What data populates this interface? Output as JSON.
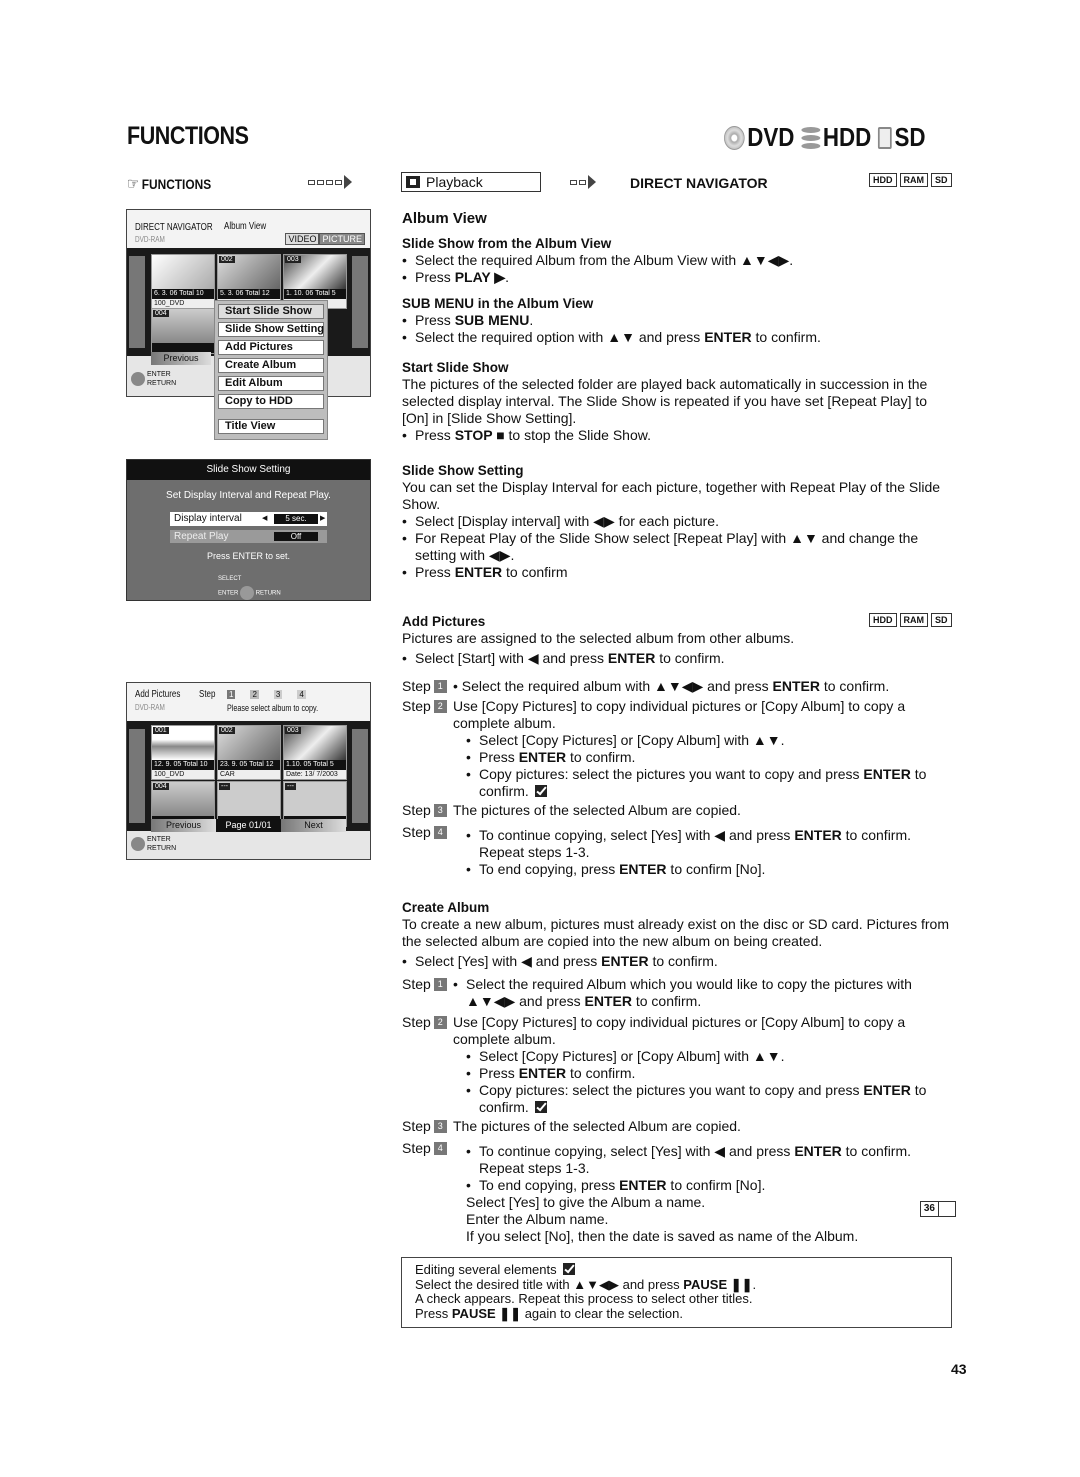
{
  "header": {
    "title": "FUNCTIONS",
    "media": [
      {
        "icon": "dvd-disc-icon",
        "label": "DVD"
      },
      {
        "icon": "hdd-icon",
        "label": "HDD"
      },
      {
        "icon": "sd-card-icon",
        "label": "SD"
      }
    ]
  },
  "breadcrumb": {
    "hand_icon": "☞",
    "functions": "FUNCTIONS",
    "playback": "Playback",
    "direct_navigator": "DIRECT NAVIGATOR",
    "badges": [
      "HDD",
      "RAM",
      "SD"
    ]
  },
  "screen_album_view": {
    "title": "DIRECT NAVIGATOR",
    "view": "Album View",
    "disc": "DVD-RAM",
    "tabs": [
      "VIDEO",
      "PICTURE"
    ],
    "thumbs": [
      {
        "num": "",
        "meta": "6. 3. 06    Total 10",
        "name": "100_DVD"
      },
      {
        "num": "002",
        "meta": "5. 3. 06    Total 12",
        "name": ""
      },
      {
        "num": "003",
        "meta": "1. 10. 06    Total 5",
        "name": ""
      },
      {
        "num": "004",
        "meta": "",
        "name": ""
      }
    ],
    "previous": "Previous",
    "enter": "ENTER",
    "return": "RETURN",
    "submenu": [
      "Start Slide Show",
      "Slide Show Setting",
      "Add Pictures",
      "Create Album",
      "Edit Album",
      "Copy to HDD",
      "Title View"
    ]
  },
  "screen_slide_setting": {
    "title": "Slide Show Setting",
    "subtitle": "Set Display Interval and Repeat Play.",
    "display_interval_label": "Display interval",
    "display_interval_value": "5 sec.",
    "repeat_play_label": "Repeat Play",
    "repeat_play_value": "Off",
    "press_enter": "Press ENTER to set.",
    "select": "SELECT",
    "enter": "ENTER",
    "return": "RETURN"
  },
  "screen_add_pictures": {
    "title": "Add Pictures",
    "step_label": "Step",
    "steps": [
      "1",
      "2",
      "3",
      "4"
    ],
    "disc": "DVD-RAM",
    "instruction": "Please select album to copy.",
    "thumbs": [
      {
        "num": "001",
        "meta": "12. 9. 05    Total 10",
        "name": "100_DVD"
      },
      {
        "num": "002",
        "meta": "23. 9. 05   Total 12",
        "name": "CAR"
      },
      {
        "num": "003",
        "meta": "1.10. 05    Total 5",
        "name": "Date: 13/ 7/2003"
      },
      {
        "num": "004",
        "meta": "",
        "name": ""
      },
      {
        "num": "---",
        "meta": "",
        "name": ""
      },
      {
        "num": "---",
        "meta": "",
        "name": ""
      }
    ],
    "previous": "Previous",
    "page": "Page 01/01",
    "next": "Next",
    "enter": "ENTER",
    "return": "RETURN"
  },
  "content": {
    "album_view": "Album View",
    "ss_from_album": {
      "heading": "Slide Show from the Album View",
      "b1": "Select the required Album from the Album View with ▲▼◀▶.",
      "b2_pre": "Press ",
      "b2_bold": "PLAY ▶",
      "b2_post": "."
    },
    "submenu_section": {
      "heading": "SUB MENU in the Album View",
      "b1_pre": "Press ",
      "b1_bold": "SUB MENU",
      "b1_post": ".",
      "b2_pre": "Select the required option with ▲▼ and press ",
      "b2_bold": "ENTER",
      "b2_post": " to confirm."
    },
    "start_slide_show": {
      "heading": "Start Slide Show",
      "body": "The pictures of the selected folder are played back automatically in succession in the selected display interval. The Slide Show is repeated if you have set [Repeat Play] to [On] in [Slide Show Setting].",
      "b1_pre": "Press ",
      "b1_bold": "STOP ■",
      "b1_post": " to stop the Slide Show."
    },
    "slide_show_setting": {
      "heading": "Slide Show Setting",
      "body": "You can set the Display Interval for each picture, together with Repeat Play of the Slide Show.",
      "b1": "Select [Display interval] with ◀▶ for each picture.",
      "b2": "For Repeat Play of the Slide Show select [Repeat Play] with ▲▼ and change the setting with ◀▶.",
      "b3_pre": "Press ",
      "b3_bold": "ENTER",
      "b3_post": " to confirm"
    },
    "add_pictures": {
      "heading": "Add Pictures",
      "badges": [
        "HDD",
        "RAM",
        "SD"
      ],
      "body": "Pictures are assigned to the selected album from other albums.",
      "b1_pre": "Select [Start] with ◀ and press ",
      "b1_bold": "ENTER",
      "b1_post": " to confirm.",
      "step_word": "Step",
      "s1_pre": "•  Select the required album with ▲▼◀▶ and press ",
      "s1_bold": "ENTER",
      "s1_post": " to confirm.",
      "s2": "Use [Copy Pictures] to copy individual pictures or [Copy Album] to copy a complete album.",
      "s2_b1": "Select [Copy Pictures] or [Copy Album] with ▲▼.",
      "s2_b2_pre": "Press ",
      "s2_b2_bold": "ENTER",
      "s2_b2_post": " to confirm.",
      "s2_b3_pre": "Copy pictures: select the pictures you want to copy and press ",
      "s2_b3_bold": "ENTER",
      "s2_b3_post": " to confirm.",
      "s3": "The pictures of the selected Album are copied.",
      "s4_b1_pre": "To continue copying, select [Yes] with ◀ and press ",
      "s4_b1_bold": "ENTER",
      "s4_b1_post": " to confirm.",
      "s4_b1_line2": "Repeat steps 1-3.",
      "s4_b2_pre": "To end copying, press ",
      "s4_b2_bold": "ENTER",
      "s4_b2_post": " to confirm [No]."
    },
    "create_album": {
      "heading": "Create Album",
      "body": "To create a new album, pictures must already exist on the disc or SD card. Pictures from the selected album are copied into the new album on being created.",
      "b1_pre": "Select [Yes] with ◀ and press ",
      "b1_bold": "ENTER",
      "b1_post": " to confirm.",
      "step_word": "Step",
      "s1_pre": "Select the required Album which you would like to copy the pictures with ▲▼◀▶ and press ",
      "s1_bold": "ENTER",
      "s1_post": " to confirm.",
      "s2": "Use [Copy Pictures] to copy individual pictures or [Copy Album] to copy a complete album.",
      "s2_b1": "Select [Copy Pictures] or [Copy Album] with ▲▼.",
      "s2_b2_pre": "Press ",
      "s2_b2_bold": "ENTER",
      "s2_b2_post": " to confirm.",
      "s2_b3_pre": "Copy pictures: select the pictures you want to copy and press ",
      "s2_b3_bold": "ENTER",
      "s2_b3_post": " to confirm.",
      "s3": "The pictures of the selected Album are copied.",
      "s4_b1_pre": "To continue copying, select [Yes] with ◀ and press ",
      "s4_b1_bold": "ENTER",
      "s4_b1_post": " to confirm.",
      "s4_b1_line2": "Repeat steps 1-3.",
      "s4_b2_pre": "To end copying, press ",
      "s4_b2_bold": "ENTER",
      "s4_b2_post": " to confirm [No].",
      "s4_l3": "Select [Yes] to give the Album a name.",
      "s4_l4": "Enter the Album name.",
      "s4_l5": "If you select [No], then the date is saved as name of the Album.",
      "page_ref": "36"
    }
  },
  "note": {
    "l1": "Editing several elements",
    "l2_pre": "Select the desired title with ▲▼◀▶ and press ",
    "l2_bold": "PAUSE ❚❚",
    "l2_post": ".",
    "l3": "A check appears. Repeat this process to select other titles.",
    "l4_pre": "Press ",
    "l4_bold": "PAUSE ❚❚",
    "l4_post": " again to clear the selection."
  },
  "page_number": "43"
}
